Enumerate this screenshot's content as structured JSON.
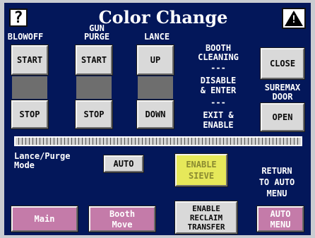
{
  "header": {
    "title": "Color Change",
    "help_glyph": "?",
    "warning_glyph": "!"
  },
  "columns": {
    "blowoff": {
      "label": "BLOWOFF",
      "start": "START",
      "stop": "STOP"
    },
    "gun_purge": {
      "label_line1": "GUN",
      "label_line2": "PURGE",
      "start": "START",
      "stop": "STOP"
    },
    "lance": {
      "label": "LANCE",
      "up": "UP",
      "down": "DOWN"
    }
  },
  "booth_cleaning": {
    "line1": "BOOTH",
    "line2": "CLEANING",
    "sep1": "---",
    "disable_line1": "DISABLE",
    "disable_line2": "& ENTER",
    "sep2": "---",
    "exit_line1": "EXIT &",
    "exit_line2": "ENABLE"
  },
  "suremax": {
    "close": "CLOSE",
    "label_line1": "SUREMAX",
    "label_line2": "DOOR",
    "open": "OPEN"
  },
  "lance_purge": {
    "label_line1": "Lance/Purge",
    "label_line2": "Mode",
    "mode_value": "AUTO"
  },
  "enable_sieve": {
    "line1": "ENABLE",
    "line2": "SIEVE"
  },
  "return_auto": {
    "line1": "RETURN",
    "line2": "TO AUTO",
    "line3": "MENU"
  },
  "footer": {
    "main": "Main",
    "booth_move_line1": "Booth",
    "booth_move_line2": "Move",
    "reclaim_line1": "ENABLE",
    "reclaim_line2": "RECLAIM",
    "reclaim_line3": "TRANSFER",
    "auto_menu_line1": "AUTO",
    "auto_menu_line2": "MENU"
  },
  "colors": {
    "background": "#03175a",
    "button_gray": "#d9d9d9",
    "button_pink": "#c47ba9",
    "button_yellow": "#e6e85a"
  }
}
